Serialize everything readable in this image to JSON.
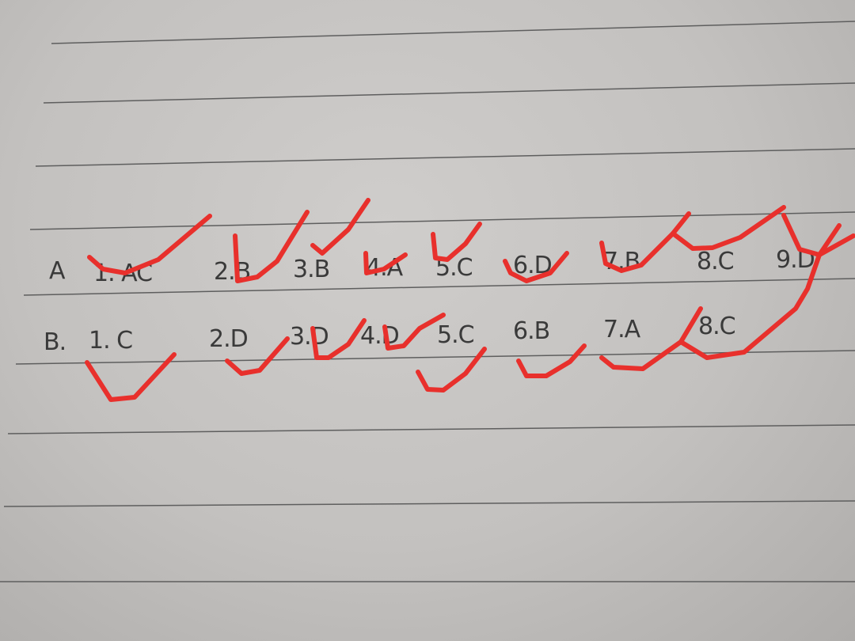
{
  "rows": [
    {
      "label": "A",
      "answers": [
        "1. AC",
        "2.B",
        "3.B",
        "4.A",
        "5.C",
        "6.D",
        "7.B",
        "8.C",
        "9.D"
      ]
    },
    {
      "label": "B.",
      "answers": [
        "1. C",
        "2.D",
        "3.D",
        "4.D",
        "5.C",
        "6.B",
        "7.A",
        "8.C"
      ]
    }
  ],
  "colors": {
    "paper": "#c8c6c4",
    "ruled_line": "#5a5a5a",
    "ink": "#3a3a3a",
    "check_marks": "#e8302c"
  }
}
